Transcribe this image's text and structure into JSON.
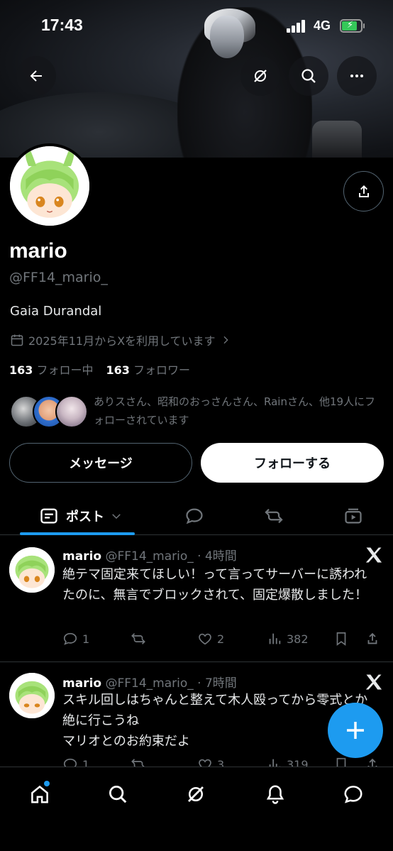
{
  "status_bar": {
    "time": "17:43",
    "network": "4G",
    "battery_level": 0.8
  },
  "header": {
    "back_icon": "arrow-left-icon",
    "grok_icon": "grok-icon",
    "search_icon": "search-icon",
    "more_icon": "more-horizontal-icon"
  },
  "profile": {
    "name": "mario",
    "handle": "@FF14_mario_",
    "bio": "Gaia Durandal",
    "joined": "2025年11月からXを利用しています",
    "following_count": "163",
    "following_label": "フォロー中",
    "followers_count": "163",
    "followers_label": "フォロワー",
    "followed_by": "ありスさん、昭和のおっさんさん、Rainさん、他19人にフォローされています",
    "message_button": "メッセージ",
    "follow_button": "フォローする"
  },
  "tabs": {
    "active_label": "ポスト"
  },
  "posts": [
    {
      "name": "mario",
      "meta": "@FF14_mario_ · 4時間",
      "text": "絶テマ固定来てほしい！って言ってサーバーに誘われたのに、無言でブロックされて、固定爆散しました！",
      "replies": "1",
      "reposts": "",
      "likes": "2",
      "views": "382"
    },
    {
      "name": "mario",
      "meta": "@FF14_mario_ · 7時間",
      "text": "スキル回しはちゃんと整えて木人殴ってから零式とか絶に行こうね\nマリオとのお約束だよ",
      "replies": "1",
      "reposts": "",
      "likes": "3",
      "views": "319"
    }
  ],
  "colors": {
    "accent": "#1d9bf0",
    "background": "#000000",
    "muted": "#71767b"
  }
}
